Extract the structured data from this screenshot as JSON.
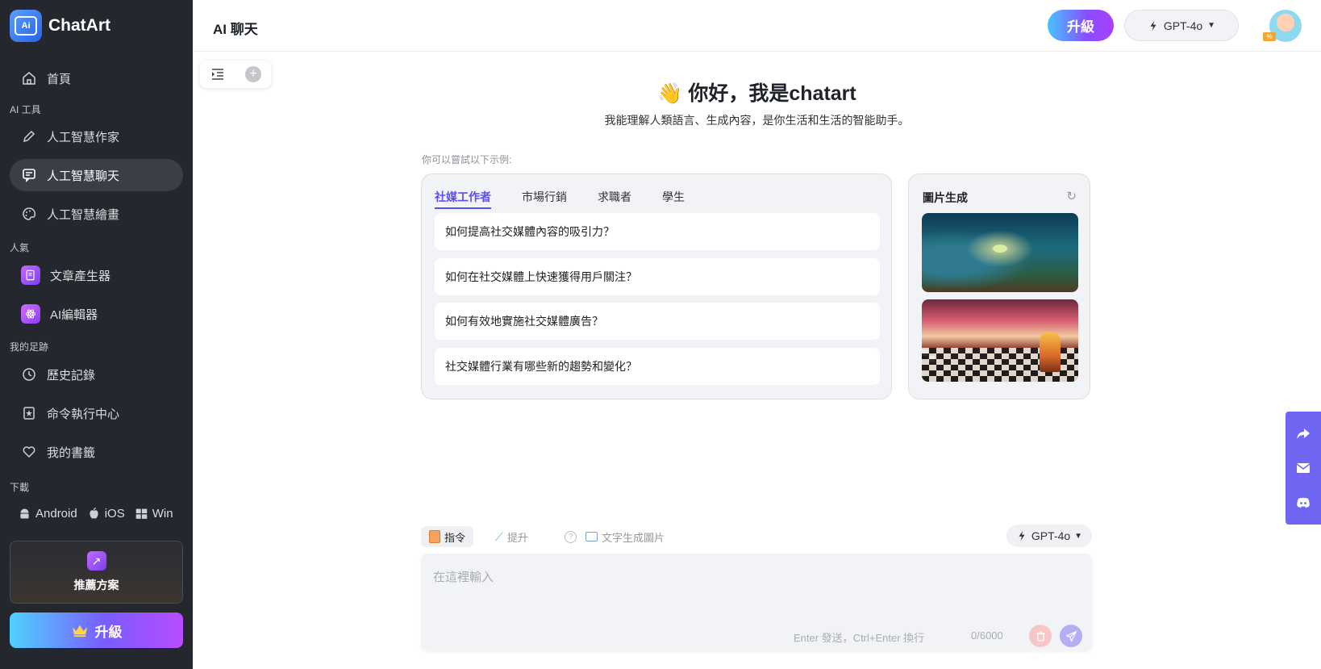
{
  "app": {
    "name": "ChatArt",
    "logo_text": "Ai"
  },
  "sidebar": {
    "home": "首頁",
    "sections": {
      "ai_tools": "AI 工具",
      "popular": "人氣",
      "footprint": "我的足跡",
      "download": "下載"
    },
    "items": {
      "writer": "人工智慧作家",
      "chat": "人工智慧聊天",
      "drawing": "人工智慧繪畫",
      "article": "文章產生器",
      "editor": "AI編輯器",
      "history": "歷史記錄",
      "commands": "命令執行中心",
      "bookmarks": "我的書籤"
    },
    "downloads": {
      "android": "Android",
      "ios": "iOS",
      "win": "Win"
    },
    "plan_card": "推薦方案",
    "upgrade": "升級"
  },
  "header": {
    "title": "AI 聊天",
    "upgrade": "升級",
    "model": "GPT-4o",
    "avatar_tag": "%"
  },
  "welcome": {
    "emoji": "👋",
    "title": "你好，我是chatart",
    "subtitle": "我能理解人類語言、生成內容，是你生活和生活的智能助手。",
    "try_label": "你可以嘗試以下示例:"
  },
  "examples": {
    "tabs": [
      "社媒工作者",
      "市場行銷",
      "求職者",
      "學生"
    ],
    "active_tab": 0,
    "prompts": [
      "如何提高社交媒體內容的吸引力？",
      "如何在社交媒體上快速獲得用戶關注？",
      "如何有效地實施社交媒體廣告？",
      "社交媒體行業有哪些新的趨勢和變化？"
    ]
  },
  "images": {
    "title": "圖片生成"
  },
  "composer": {
    "modes": [
      "指令",
      "提升",
      "文字生成圖片"
    ],
    "model": "GPT-4o",
    "placeholder": "在這裡輸入",
    "hint": "Enter 發送，Ctrl+Enter 換行",
    "counter": "0/6000"
  },
  "colors": {
    "sidebar_bg": "#25272e",
    "accent": "#5b4ff0",
    "float_bar": "#6f66f2"
  }
}
